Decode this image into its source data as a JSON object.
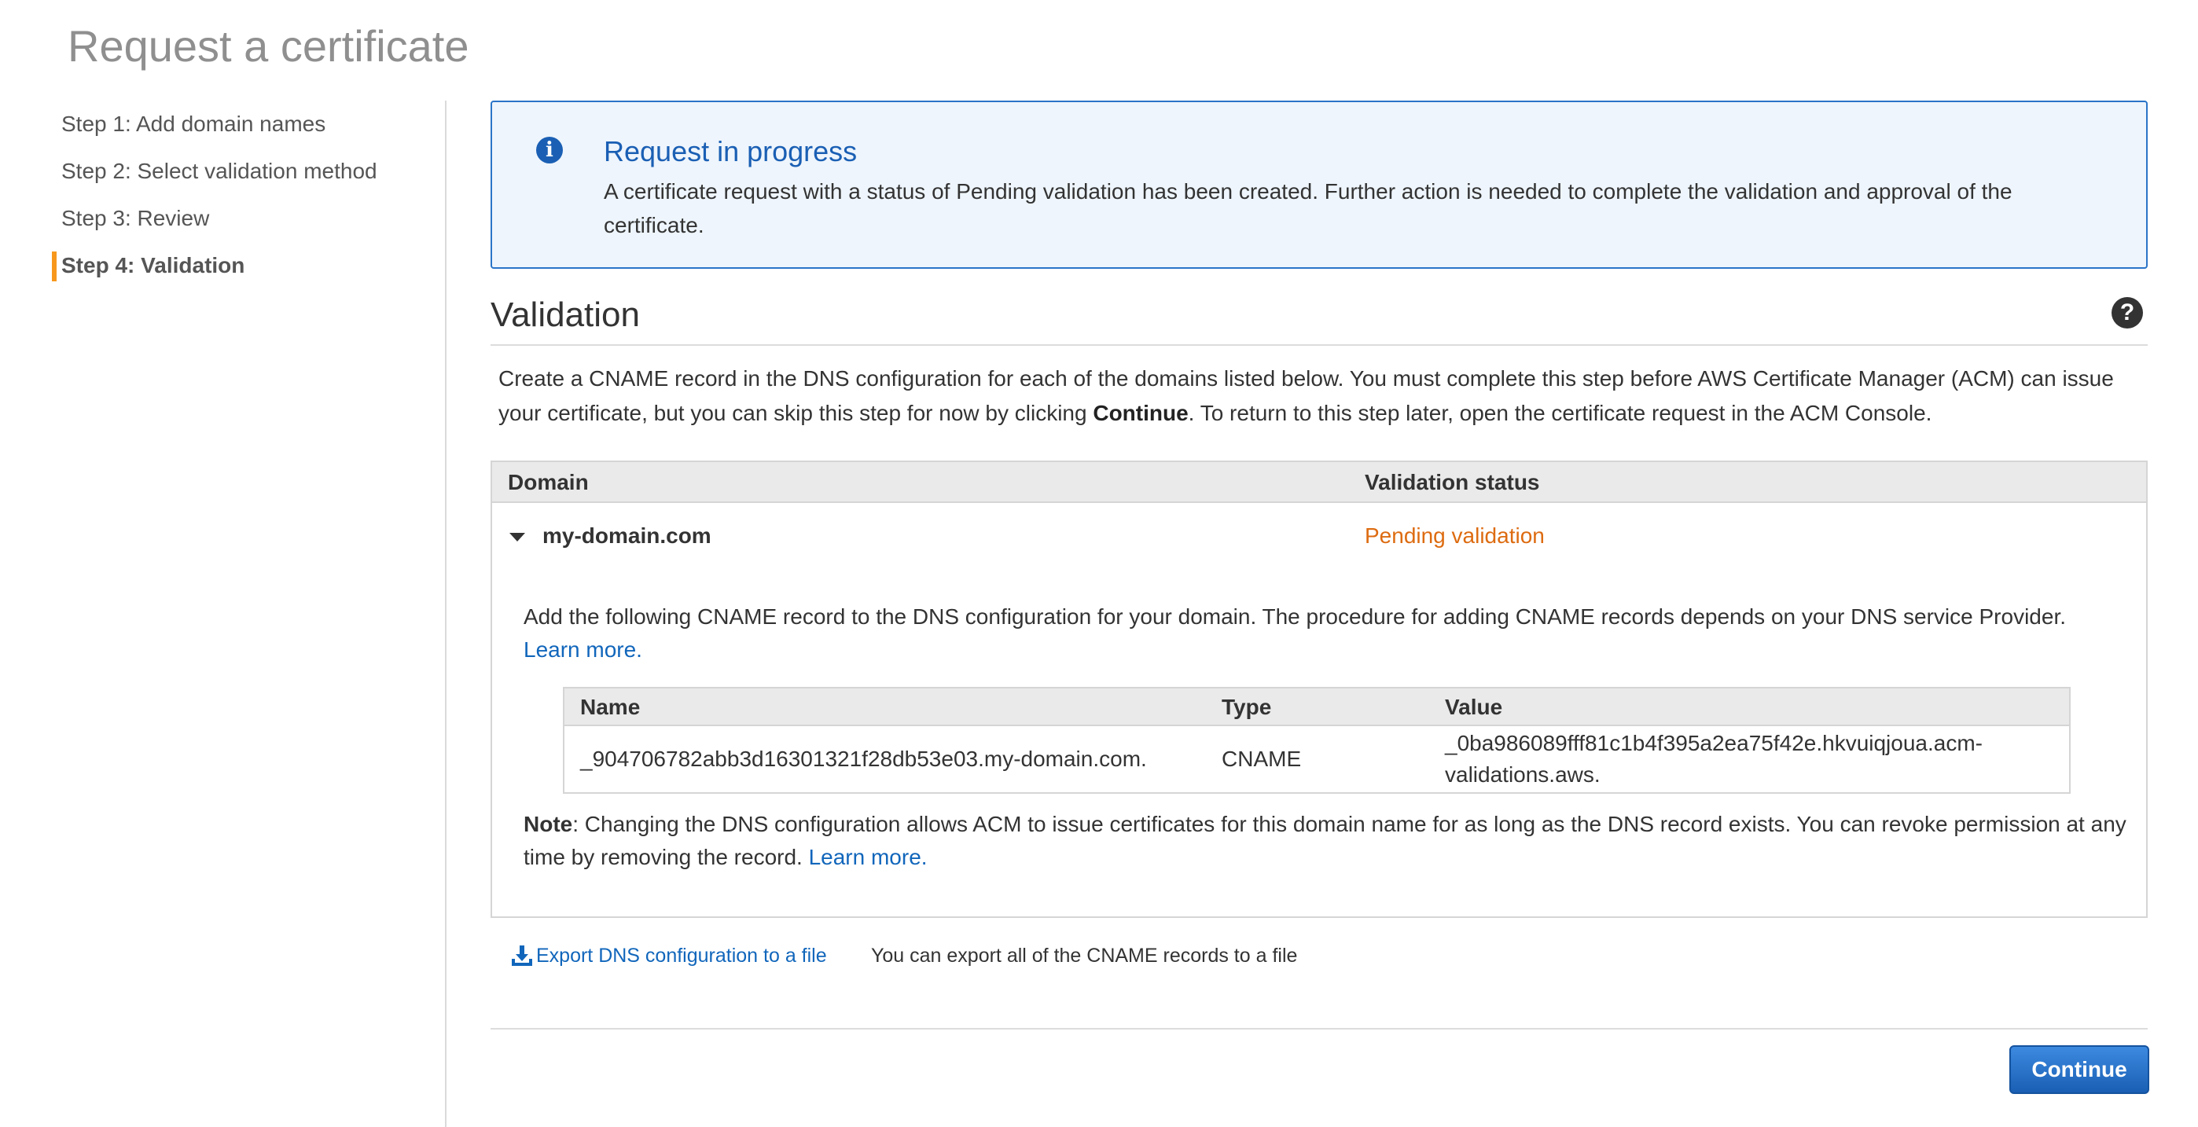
{
  "page": {
    "title": "Request a certificate"
  },
  "steps": [
    {
      "label": "Step 1: Add domain names",
      "active": false
    },
    {
      "label": "Step 2: Select validation method",
      "active": false
    },
    {
      "label": "Step 3: Review",
      "active": false
    },
    {
      "label": "Step 4: Validation",
      "active": true
    }
  ],
  "info": {
    "title": "Request in progress",
    "text": "A certificate request with a status of Pending validation has been created. Further action is needed to complete the validation and approval of the certificate.",
    "icon": "info-icon",
    "accent": "#1a5fb4"
  },
  "validation": {
    "title": "Validation",
    "intro_part1": "Create a CNAME record in the DNS configuration for each of the domains listed below. You must complete this step before AWS Certificate Manager (ACM) can issue your certificate, but you can skip this step for now by clicking ",
    "intro_bold": "Continue",
    "intro_part2": ". To return to this step later, open the certificate request in the ACM Console."
  },
  "domain_table": {
    "headers": [
      "Domain",
      "Validation status"
    ],
    "row": {
      "domain": "my-domain.com",
      "status": "Pending validation",
      "status_color": "#dd6b10",
      "detail_text": "Add the following CNAME record to the DNS configuration for your domain. The procedure for adding CNAME records depends on your DNS service Provider. ",
      "learn_more": "Learn more.",
      "cname": {
        "headers": [
          "Name",
          "Type",
          "Value"
        ],
        "name": "_904706782abb3d16301321f28db53e03.my-domain.com.",
        "type": "CNAME",
        "value": "_0ba986089fff81c1b4f395a2ea75f42e.hkvuiqjoua.acm-validations.aws."
      },
      "note_bold": "Note",
      "note_text": ": Changing the DNS configuration allows ACM to issue certificates for this domain name for as long as the DNS record exists. You can revoke permission at any time by removing the record. ",
      "note_link": "Learn more."
    }
  },
  "export": {
    "link_label": "Export DNS configuration to a file",
    "help_text": "You can export all of the CNAME records to a file"
  },
  "actions": {
    "continue_label": "Continue"
  }
}
